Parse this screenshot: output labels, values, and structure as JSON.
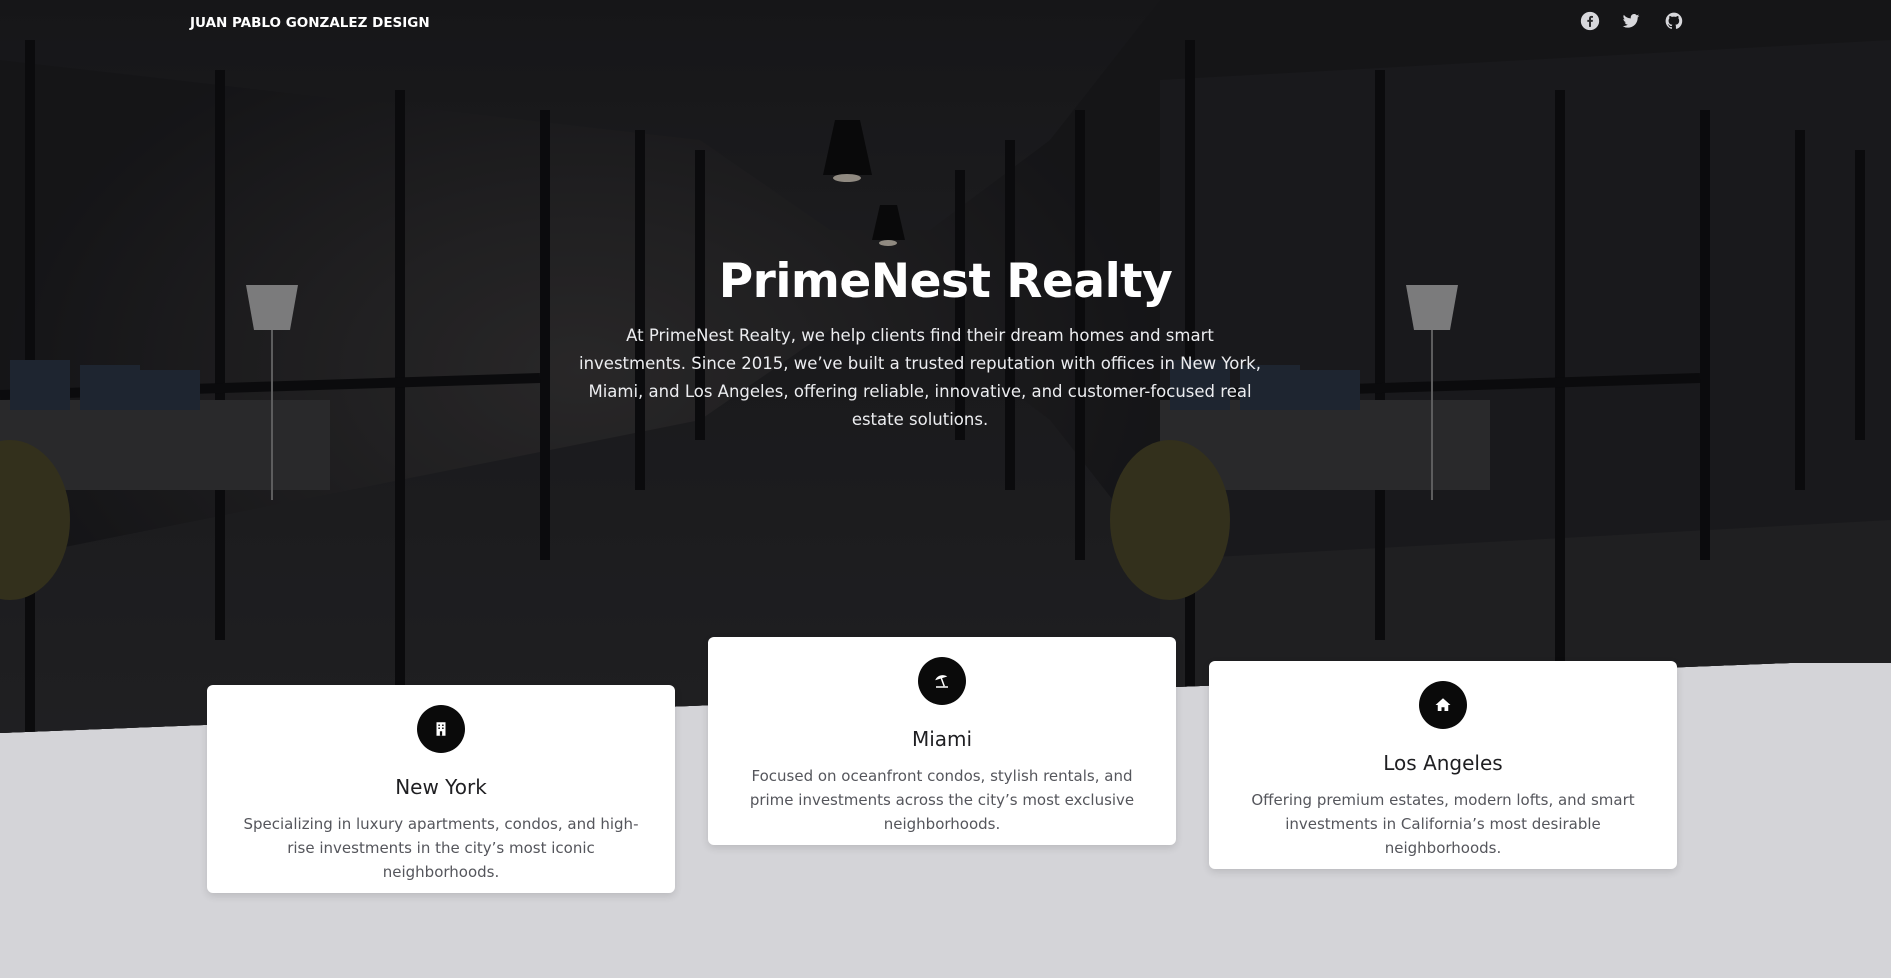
{
  "navbar": {
    "brand": "JUAN PABLO GONZALEZ DESIGN",
    "social": [
      {
        "icon": "facebook-icon"
      },
      {
        "icon": "twitter-icon"
      },
      {
        "icon": "github-icon"
      }
    ]
  },
  "hero": {
    "title": "PrimeNest Realty",
    "description": "At PrimeNest Realty, we help clients find their dream homes and smart investments. Since 2015, we’ve built a trusted reputation with offices in New York, Miami, and Los Angeles, offering reliable, innovative, and customer-focused real estate solutions."
  },
  "cards": [
    {
      "icon": "building-icon",
      "title": "New York",
      "text": "Specializing in luxury apartments, condos, and high-rise investments in the city’s most iconic neighborhoods."
    },
    {
      "icon": "umbrella-beach-icon",
      "title": "Miami",
      "text": "Focused on oceanfront condos, stylish rentals, and prime investments across the city’s most exclusive neighborhoods."
    },
    {
      "icon": "home-icon",
      "title": "Los Angeles",
      "text": "Offering premium estates, modern lofts, and smart investments in California’s most desirable neighborhoods."
    }
  ],
  "colors": {
    "hero_overlay": "#1b1b1d",
    "page_background": "#d4d4d8",
    "card_background": "#ffffff",
    "icon_circle": "#0a0a0a"
  }
}
